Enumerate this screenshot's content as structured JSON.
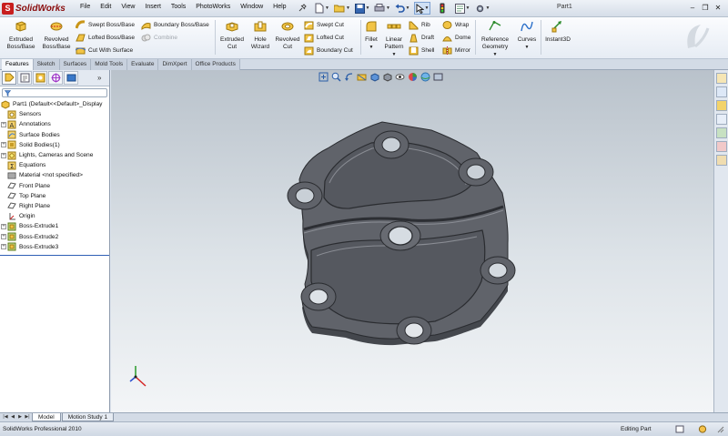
{
  "app": {
    "logo_mark": "S",
    "logo_text": "SolidWorks",
    "document_title": "Part1"
  },
  "menu": [
    "File",
    "Edit",
    "View",
    "Insert",
    "Tools",
    "PhotoWorks",
    "Window",
    "Help"
  ],
  "window_controls": [
    "minimize",
    "restore",
    "close"
  ],
  "ribbon": {
    "extruded_boss": "Extruded Boss/Base",
    "revolved_boss": "Revolved Boss/Base",
    "swept_boss": "Swept Boss/Base",
    "lofted_boss": "Lofted Boss/Base",
    "boundary_boss": "Boundary Boss/Base",
    "combine": "Combine",
    "cut_with_surface": "Cut With Surface",
    "extruded_cut": "Extruded Cut",
    "hole_wizard": "Hole Wizard",
    "revolved_cut": "Revolved Cut",
    "swept_cut": "Swept Cut",
    "lofted_cut": "Lofted Cut",
    "boundary_cut": "Boundary Cut",
    "fillet": "Fillet",
    "linear_pattern": "Linear Pattern",
    "rib": "Rib",
    "draft": "Draft",
    "shell": "Shell",
    "wrap": "Wrap",
    "dome": "Dome",
    "mirror": "Mirror",
    "reference_geometry": "Reference Geometry",
    "curves": "Curves",
    "instant3d": "Instant3D"
  },
  "cm_tabs": [
    "Features",
    "Sketch",
    "Surfaces",
    "Mold Tools",
    "Evaluate",
    "DimXpert",
    "Office Products"
  ],
  "cm_active_tab": "Features",
  "feature_tree": {
    "root": "Part1  (Default<<Default>_Display",
    "items": [
      {
        "label": "Sensors",
        "icon": "sensor-icon",
        "expand": ""
      },
      {
        "label": "Annotations",
        "icon": "annotation-icon",
        "expand": "+"
      },
      {
        "label": "Surface Bodies",
        "icon": "surface-bodies-icon",
        "expand": ""
      },
      {
        "label": "Solid Bodies(1)",
        "icon": "solid-bodies-icon",
        "expand": "+"
      },
      {
        "label": "Lights, Cameras and Scene",
        "icon": "lights-icon",
        "expand": "+"
      },
      {
        "label": "Equations",
        "icon": "equations-icon",
        "expand": ""
      },
      {
        "label": "Material <not specified>",
        "icon": "material-icon",
        "expand": ""
      },
      {
        "label": "Front Plane",
        "icon": "plane-icon",
        "expand": ""
      },
      {
        "label": "Top Plane",
        "icon": "plane-icon",
        "expand": ""
      },
      {
        "label": "Right Plane",
        "icon": "plane-icon",
        "expand": ""
      },
      {
        "label": "Origin",
        "icon": "origin-icon",
        "expand": ""
      },
      {
        "label": "Boss-Extrude1",
        "icon": "extrude-icon",
        "expand": "+"
      },
      {
        "label": "Boss-Extrude2",
        "icon": "extrude-icon",
        "expand": "+"
      },
      {
        "label": "Boss-Extrude3",
        "icon": "extrude-icon",
        "expand": "+"
      }
    ]
  },
  "fm_more": "»",
  "bottom_tabs": [
    "Model",
    "Motion Study 1"
  ],
  "bottom_active_tab": "Model",
  "status": {
    "product": "SolidWorks Professional 2010",
    "mode": "Editing Part"
  },
  "colors": {
    "part_face": "#5f6268",
    "part_side": "#4a4d53",
    "logo_red": "#c81e1e",
    "fm_selection_line": "#2f5fb5"
  }
}
